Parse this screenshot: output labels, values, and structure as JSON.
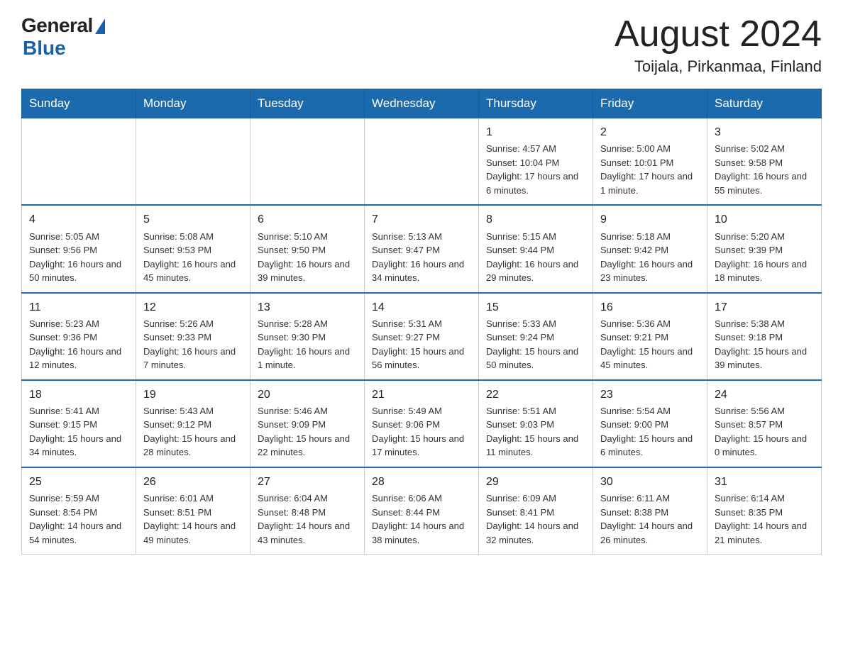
{
  "logo": {
    "general": "General",
    "blue": "Blue"
  },
  "header": {
    "title": "August 2024",
    "subtitle": "Toijala, Pirkanmaa, Finland"
  },
  "weekdays": [
    "Sunday",
    "Monday",
    "Tuesday",
    "Wednesday",
    "Thursday",
    "Friday",
    "Saturday"
  ],
  "weeks": [
    [
      {
        "day": "",
        "info": ""
      },
      {
        "day": "",
        "info": ""
      },
      {
        "day": "",
        "info": ""
      },
      {
        "day": "",
        "info": ""
      },
      {
        "day": "1",
        "info": "Sunrise: 4:57 AM\nSunset: 10:04 PM\nDaylight: 17 hours and 6 minutes."
      },
      {
        "day": "2",
        "info": "Sunrise: 5:00 AM\nSunset: 10:01 PM\nDaylight: 17 hours and 1 minute."
      },
      {
        "day": "3",
        "info": "Sunrise: 5:02 AM\nSunset: 9:58 PM\nDaylight: 16 hours and 55 minutes."
      }
    ],
    [
      {
        "day": "4",
        "info": "Sunrise: 5:05 AM\nSunset: 9:56 PM\nDaylight: 16 hours and 50 minutes."
      },
      {
        "day": "5",
        "info": "Sunrise: 5:08 AM\nSunset: 9:53 PM\nDaylight: 16 hours and 45 minutes."
      },
      {
        "day": "6",
        "info": "Sunrise: 5:10 AM\nSunset: 9:50 PM\nDaylight: 16 hours and 39 minutes."
      },
      {
        "day": "7",
        "info": "Sunrise: 5:13 AM\nSunset: 9:47 PM\nDaylight: 16 hours and 34 minutes."
      },
      {
        "day": "8",
        "info": "Sunrise: 5:15 AM\nSunset: 9:44 PM\nDaylight: 16 hours and 29 minutes."
      },
      {
        "day": "9",
        "info": "Sunrise: 5:18 AM\nSunset: 9:42 PM\nDaylight: 16 hours and 23 minutes."
      },
      {
        "day": "10",
        "info": "Sunrise: 5:20 AM\nSunset: 9:39 PM\nDaylight: 16 hours and 18 minutes."
      }
    ],
    [
      {
        "day": "11",
        "info": "Sunrise: 5:23 AM\nSunset: 9:36 PM\nDaylight: 16 hours and 12 minutes."
      },
      {
        "day": "12",
        "info": "Sunrise: 5:26 AM\nSunset: 9:33 PM\nDaylight: 16 hours and 7 minutes."
      },
      {
        "day": "13",
        "info": "Sunrise: 5:28 AM\nSunset: 9:30 PM\nDaylight: 16 hours and 1 minute."
      },
      {
        "day": "14",
        "info": "Sunrise: 5:31 AM\nSunset: 9:27 PM\nDaylight: 15 hours and 56 minutes."
      },
      {
        "day": "15",
        "info": "Sunrise: 5:33 AM\nSunset: 9:24 PM\nDaylight: 15 hours and 50 minutes."
      },
      {
        "day": "16",
        "info": "Sunrise: 5:36 AM\nSunset: 9:21 PM\nDaylight: 15 hours and 45 minutes."
      },
      {
        "day": "17",
        "info": "Sunrise: 5:38 AM\nSunset: 9:18 PM\nDaylight: 15 hours and 39 minutes."
      }
    ],
    [
      {
        "day": "18",
        "info": "Sunrise: 5:41 AM\nSunset: 9:15 PM\nDaylight: 15 hours and 34 minutes."
      },
      {
        "day": "19",
        "info": "Sunrise: 5:43 AM\nSunset: 9:12 PM\nDaylight: 15 hours and 28 minutes."
      },
      {
        "day": "20",
        "info": "Sunrise: 5:46 AM\nSunset: 9:09 PM\nDaylight: 15 hours and 22 minutes."
      },
      {
        "day": "21",
        "info": "Sunrise: 5:49 AM\nSunset: 9:06 PM\nDaylight: 15 hours and 17 minutes."
      },
      {
        "day": "22",
        "info": "Sunrise: 5:51 AM\nSunset: 9:03 PM\nDaylight: 15 hours and 11 minutes."
      },
      {
        "day": "23",
        "info": "Sunrise: 5:54 AM\nSunset: 9:00 PM\nDaylight: 15 hours and 6 minutes."
      },
      {
        "day": "24",
        "info": "Sunrise: 5:56 AM\nSunset: 8:57 PM\nDaylight: 15 hours and 0 minutes."
      }
    ],
    [
      {
        "day": "25",
        "info": "Sunrise: 5:59 AM\nSunset: 8:54 PM\nDaylight: 14 hours and 54 minutes."
      },
      {
        "day": "26",
        "info": "Sunrise: 6:01 AM\nSunset: 8:51 PM\nDaylight: 14 hours and 49 minutes."
      },
      {
        "day": "27",
        "info": "Sunrise: 6:04 AM\nSunset: 8:48 PM\nDaylight: 14 hours and 43 minutes."
      },
      {
        "day": "28",
        "info": "Sunrise: 6:06 AM\nSunset: 8:44 PM\nDaylight: 14 hours and 38 minutes."
      },
      {
        "day": "29",
        "info": "Sunrise: 6:09 AM\nSunset: 8:41 PM\nDaylight: 14 hours and 32 minutes."
      },
      {
        "day": "30",
        "info": "Sunrise: 6:11 AM\nSunset: 8:38 PM\nDaylight: 14 hours and 26 minutes."
      },
      {
        "day": "31",
        "info": "Sunrise: 6:14 AM\nSunset: 8:35 PM\nDaylight: 14 hours and 21 minutes."
      }
    ]
  ]
}
